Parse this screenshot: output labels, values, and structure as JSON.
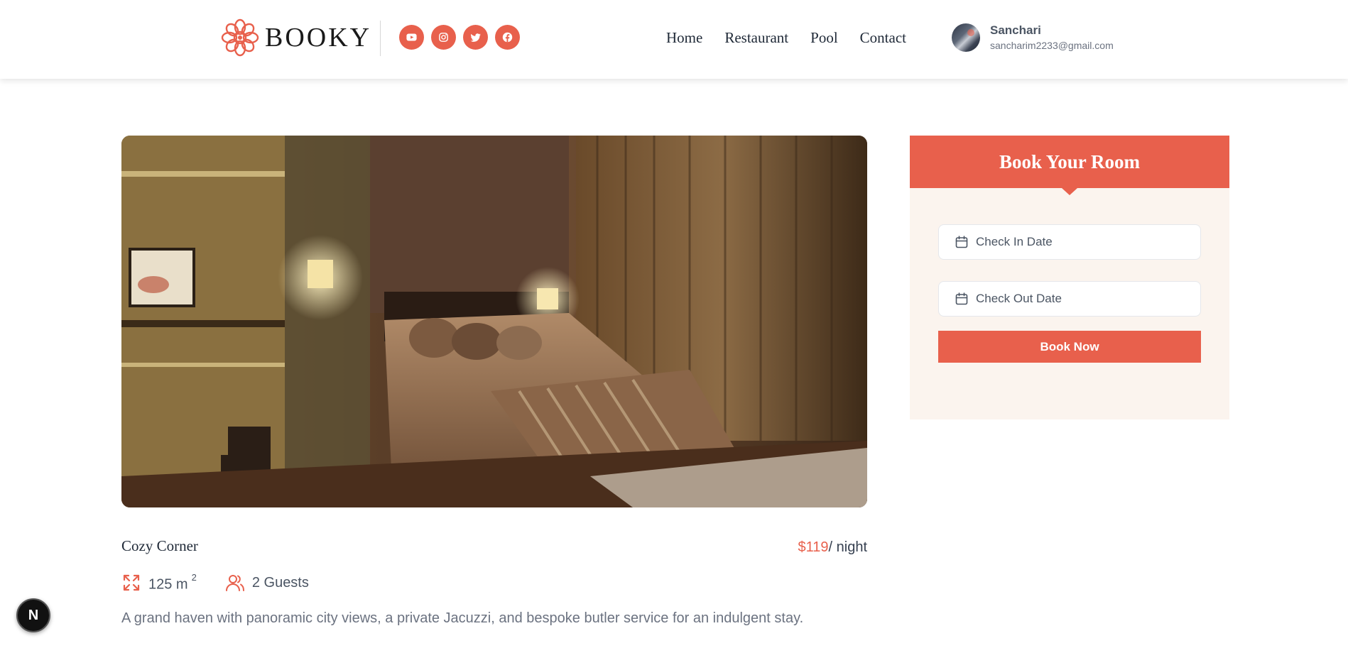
{
  "brand": {
    "name": "BOOKY",
    "logo_icon": "lotus-logo-icon",
    "accent": "#e8604c"
  },
  "socials": [
    {
      "name": "youtube",
      "icon": "youtube-icon"
    },
    {
      "name": "instagram",
      "icon": "instagram-icon"
    },
    {
      "name": "twitter",
      "icon": "twitter-icon"
    },
    {
      "name": "facebook",
      "icon": "facebook-icon"
    }
  ],
  "nav": {
    "items": [
      "Home",
      "Restaurant",
      "Pool",
      "Contact"
    ]
  },
  "user": {
    "name": "Sanchari",
    "email": "sancharim2233@gmail.com"
  },
  "room": {
    "name": "Cozy Corner",
    "price_amount": "$119",
    "price_unit": "/ night",
    "size_value": "125 m",
    "size_sup": "2",
    "guests": "2 Guests",
    "description": "A grand haven with panoramic city views, a private Jacuzzi, and bespoke butler service for an indulgent stay."
  },
  "booking": {
    "title": "Book Your Room",
    "checkin_label": "Check In Date",
    "checkout_label": "Check Out Date",
    "button_label": "Book Now"
  },
  "badge": {
    "letter": "N"
  }
}
